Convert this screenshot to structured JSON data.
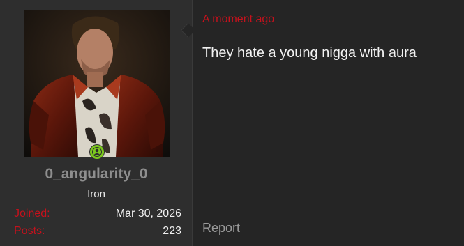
{
  "author": {
    "username": "0_angularity_0",
    "title": "Iron",
    "online_status_icon": "user-online-icon",
    "stats": [
      {
        "label": "Joined:",
        "value": "Mar 30, 2026"
      },
      {
        "label": "Posts:",
        "value": "223"
      }
    ]
  },
  "post": {
    "timestamp": "A moment ago",
    "message": "They hate a young nigga with aura",
    "report_label": "Report"
  },
  "colors": {
    "accent": "#c6111c",
    "online": "#7cc61e",
    "panel": "#2e2e2e",
    "body": "#252525"
  }
}
